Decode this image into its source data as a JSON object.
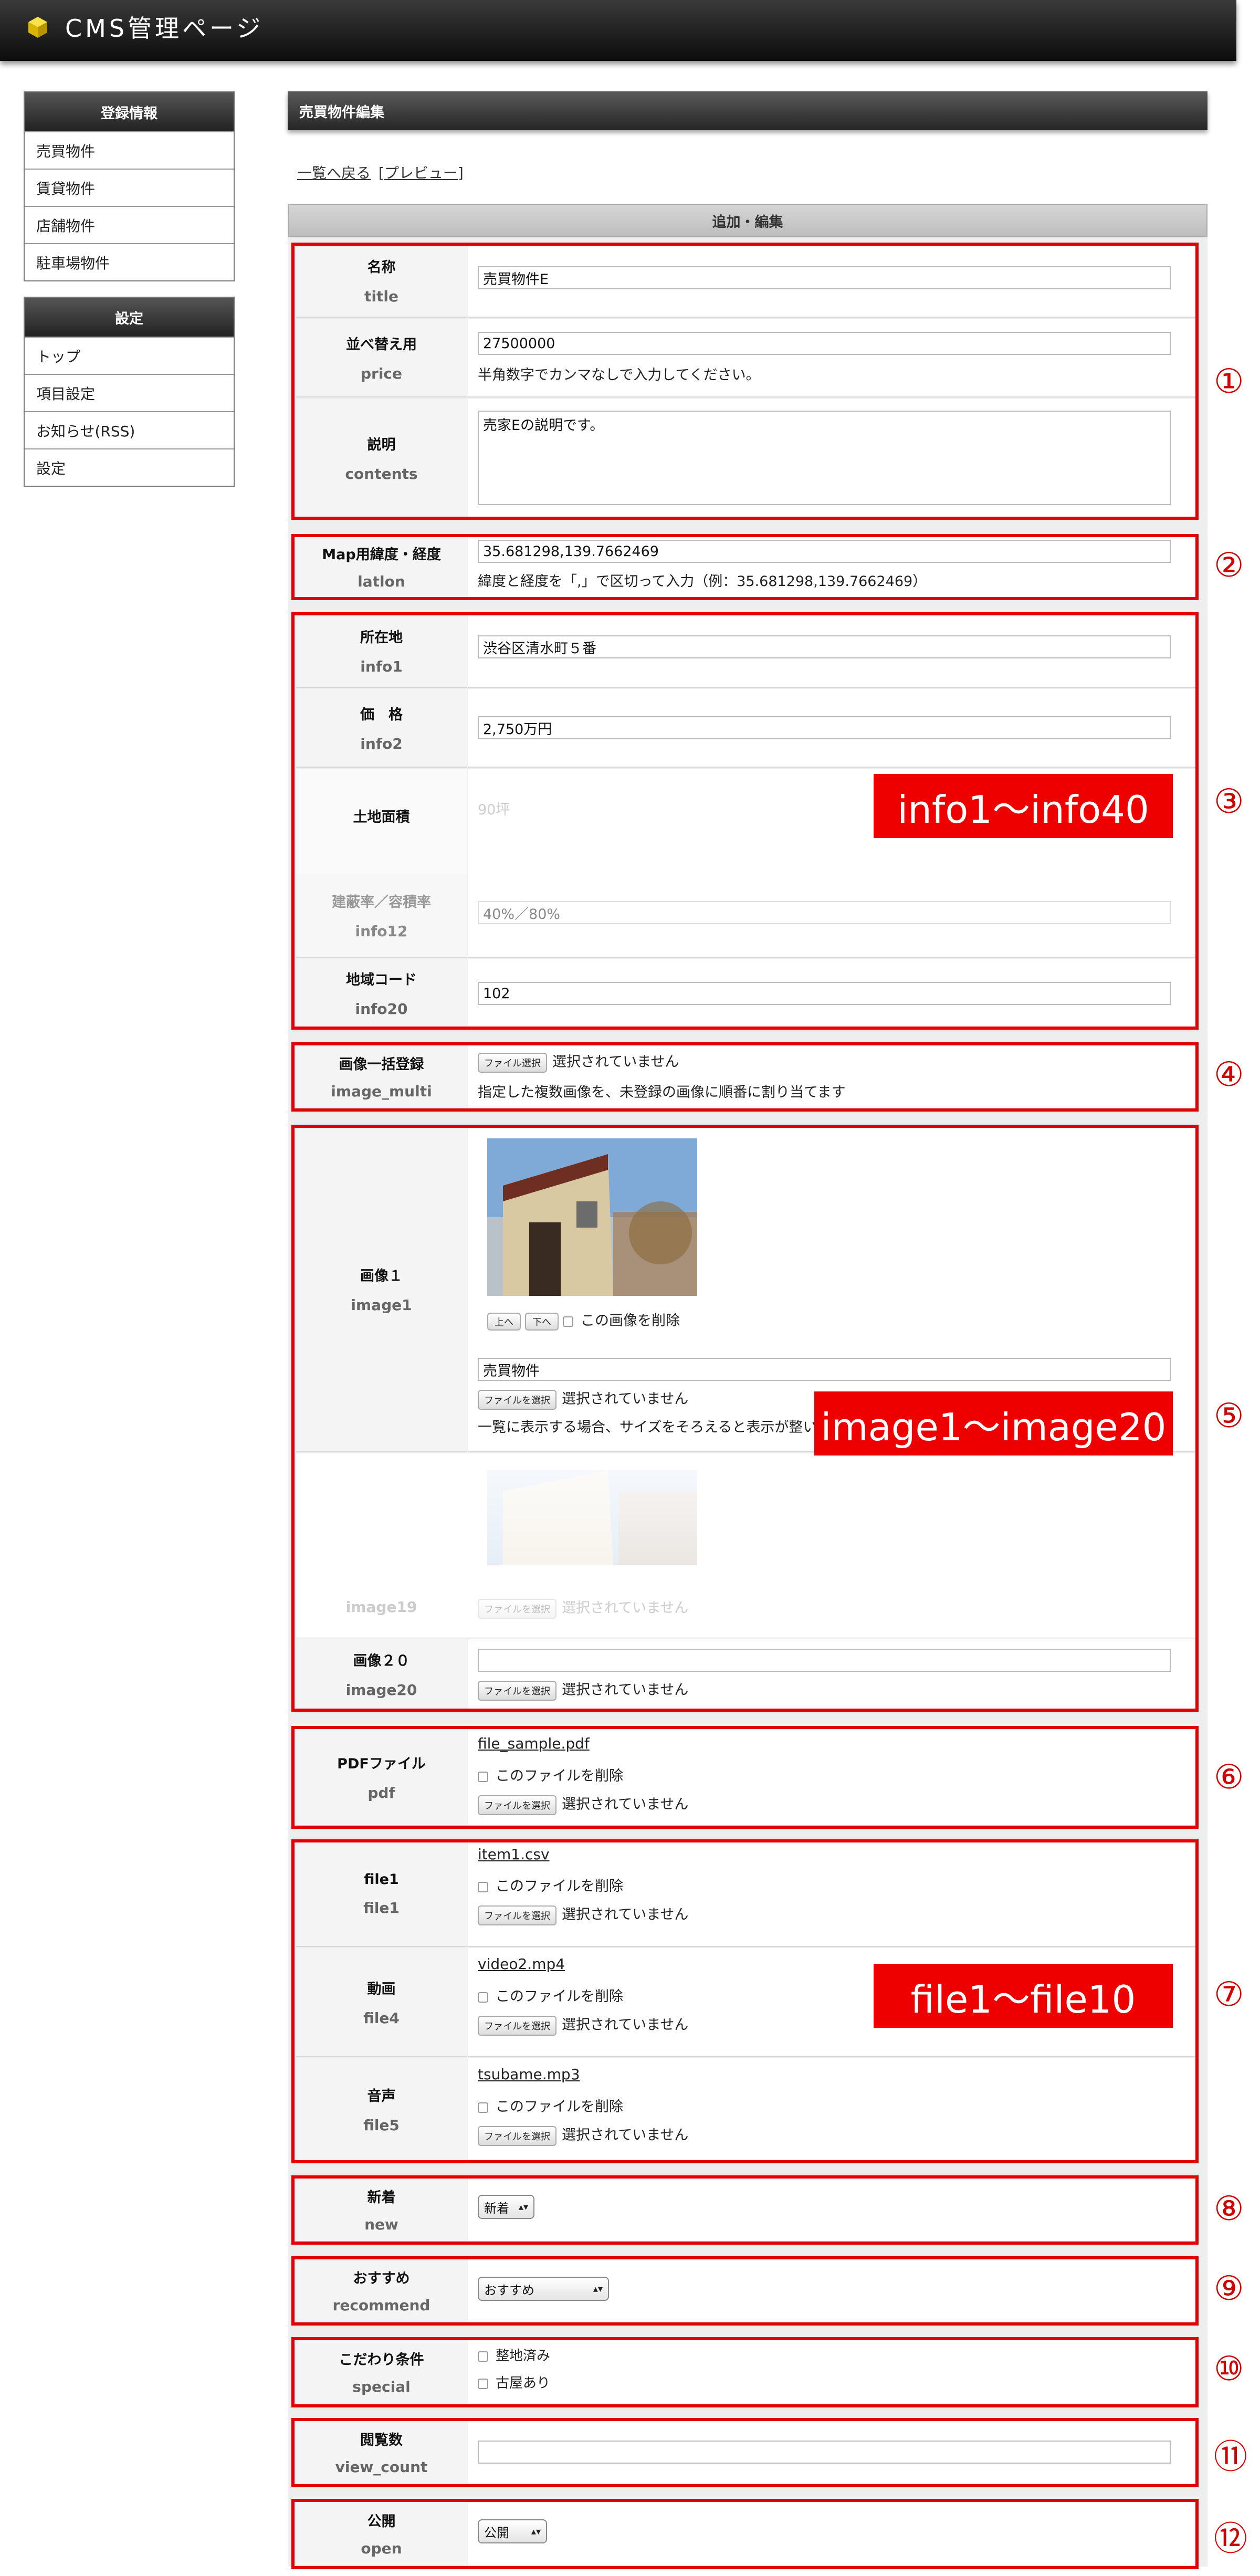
{
  "header": {
    "title": "CMS管理ページ"
  },
  "sidebar": {
    "groups": [
      {
        "title": "登録情報",
        "items": [
          "売買物件",
          "賃貸物件",
          "店舗物件",
          "駐車場物件"
        ]
      },
      {
        "title": "設定",
        "items": [
          "トップ",
          "項目設定",
          "お知らせ(RSS)",
          "設定"
        ]
      }
    ]
  },
  "main": {
    "title": "売買物件編集",
    "back_link": "一覧へ戻る",
    "preview_link": "[プレビュー]",
    "form_caption": "追加・編集"
  },
  "fields": {
    "title": {
      "ja": "名称",
      "en": "title",
      "value": "売買物件E"
    },
    "price": {
      "ja": "並べ替え用",
      "en": "price",
      "value": "27500000",
      "note": "半角数字でカンマなしで入力してください。"
    },
    "contents": {
      "ja": "説明",
      "en": "contents",
      "value": "売家Eの説明です。"
    },
    "latlon": {
      "ja": "Map用緯度・経度",
      "en": "latlon",
      "value": "35.681298,139.7662469",
      "note": "緯度と経度を「,」で区切って入力（例：35.681298,139.7662469）"
    },
    "info1": {
      "ja": "所在地",
      "en": "info1",
      "value": "渋谷区清水町５番"
    },
    "info2": {
      "ja": "価　格",
      "en": "info2",
      "value": "2,750万円"
    },
    "info_faded": {
      "ja": "土地面積",
      "value": "90坪"
    },
    "info12": {
      "ja": "建蔽率／容積率",
      "en": "info12",
      "value": "40%／80%"
    },
    "info20": {
      "ja": "地域コード",
      "en": "info20",
      "value": "102"
    },
    "image_multi": {
      "ja": "画像一括登録",
      "en": "image_multi",
      "file_button": "ファイル選択",
      "file_status": "選択されていません",
      "note": "指定した複数画像を、未登録の画像に順番に割り当てます"
    },
    "image1": {
      "ja": "画像１",
      "en": "image1",
      "up": "上へ",
      "down": "下へ",
      "delete_label": "この画像を削除",
      "caption": "売買物件",
      "file_button": "ファイルを選択",
      "file_status": "選択されていません",
      "note": "一覧に表示する場合、サイズをそろえると表示が整います"
    },
    "image19": {
      "en": "image19",
      "file_button": "ファイルを選択",
      "file_status": "選択されていません"
    },
    "image20": {
      "ja": "画像２０",
      "en": "image20",
      "file_button": "ファイルを選択",
      "file_status": "選択されていません"
    },
    "pdf": {
      "ja": "PDFファイル",
      "en": "pdf",
      "filename": "file_sample.pdf",
      "delete_label": "このファイルを削除",
      "file_button": "ファイルを選択",
      "file_status": "選択されていません"
    },
    "file1": {
      "ja": "file1",
      "en": "file1",
      "filename": "item1.csv",
      "delete_label": "このファイルを削除",
      "file_button": "ファイルを選択",
      "file_status": "選択されていません"
    },
    "file4": {
      "ja": "動画",
      "en": "file4",
      "filename": "video2.mp4",
      "delete_label": "このファイルを削除",
      "file_button": "ファイルを選択",
      "file_status": "選択されていません"
    },
    "file5": {
      "ja": "音声",
      "en": "file5",
      "filename": "tsubame.mp3",
      "delete_label": "このファイルを削除",
      "file_button": "ファイルを選択",
      "file_status": "選択されていません"
    },
    "new": {
      "ja": "新着",
      "en": "new",
      "selected": "新着"
    },
    "recommend": {
      "ja": "おすすめ",
      "en": "recommend",
      "selected": "おすすめ"
    },
    "special": {
      "ja": "こだわり条件",
      "en": "special",
      "options": [
        "整地済み",
        "古屋あり"
      ]
    },
    "view_count": {
      "ja": "閲覧数",
      "en": "view_count",
      "value": ""
    },
    "open": {
      "ja": "公開",
      "en": "open",
      "selected": "公開"
    }
  },
  "annotations": {
    "numbers": [
      "①",
      "②",
      "③",
      "④",
      "⑤",
      "⑥",
      "⑦",
      "⑧",
      "⑨",
      "⑩",
      "⑪",
      "⑫"
    ],
    "overlays": [
      "info1〜info40",
      "image1〜image20",
      "file1〜file10"
    ],
    "color": "#ee0000"
  }
}
